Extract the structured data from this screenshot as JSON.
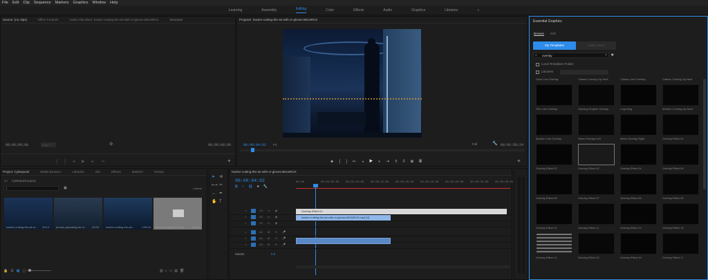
{
  "menu": [
    "File",
    "Edit",
    "Clip",
    "Sequence",
    "Markers",
    "Graphics",
    "Window",
    "Help"
  ],
  "workspaces": [
    "Learning",
    "Assembly",
    "Editing",
    "Color",
    "Effects",
    "Audio",
    "Graphics",
    "Libraries"
  ],
  "workspace_more": "»",
  "source": {
    "tabs": [
      "Source: (no clips)",
      "Effect Controls",
      "Audio Clip Mixer: hacker-cutting-the-air-with-vr-gloves-BNJ4RCK",
      "Metadata"
    ],
    "tc_left": "00;00;00;00",
    "tc_right": "00;00;00;00",
    "page_label": "Page 1"
  },
  "program": {
    "title": "Program: hacker-cutting-the-air-with-vr-gloves-BNJ4RCK",
    "tc_current": "00:00:04:02",
    "fit": "Fit",
    "quality": "Full",
    "tc_end": "00:01:59:24"
  },
  "essential": {
    "title": "Essential Graphics",
    "tabs": [
      "Browse",
      "Edit"
    ],
    "my_templates": "My Templates",
    "adobe_stock": "Adobe Stock",
    "search_value": "overlay",
    "local_folder": "Local Templates Folder",
    "libraries": "Libraries",
    "top_row": [
      "Glow Line Overlay",
      "Classic Coming Up Next",
      "Classic Line Overlay",
      "Classic Coming Up Next"
    ],
    "items": [
      "Film Line Overlay",
      "Gaming Graphic Overlay",
      "Logo Bug",
      "Modern Coming Up Next",
      "Modern Line Overlay",
      "News Overlay Left",
      "News Overlay Right",
      "Overlay Effect 01",
      "Overlay Effect 02",
      "Overlay Effect 03",
      "Overlay Effect 04",
      "Overlay Effect 05",
      "Overlay Effect 06",
      "Overlay Effect 07",
      "Overlay Effect 08",
      "Overlay Effect 09",
      "Overlay Effect 10",
      "Overlay Effect 11",
      "Overlay Effect 12",
      "Overlay Effect 13",
      "Overlay Effect 14",
      "Overlay Effect 15",
      "Overlay Effect 16",
      "Overlay Effect 17"
    ]
  },
  "project": {
    "tabs": [
      "Project: Cyberpunk",
      "Media Browser",
      "Libraries",
      "Info",
      "Effects",
      "Markers",
      "History"
    ],
    "file": "Cyberpunk.prproj",
    "items_count": "4 items",
    "items": [
      {
        "name": "hacker-cutting-the-air-w...",
        "dur": "19:14"
      },
      {
        "name": "person-preparing-for-vr...",
        "dur": "20:00"
      },
      {
        "name": "hacker-cutting-the-air-...",
        "dur": "1:59:24"
      },
      {
        "name": "Motion Graphics Templ...",
        "dur": "0 items"
      }
    ]
  },
  "timeline": {
    "tab": "hacker-cutting-the-air-with-vr-gloves-BNJ4RCK",
    "tc": "00:00:04:02",
    "ruler": [
      "00:00",
      "00:00:05:00",
      "00:00:10:00",
      "00:00:15:00",
      "00:00:20:00",
      "00:00:25:00",
      "00:00:30:00",
      "00:00:35:00",
      "00:00:40:00"
    ],
    "tracks": [
      "V3",
      "V2",
      "V1",
      "A1",
      "A2",
      "A3"
    ],
    "master": "Master",
    "master_val": "0.0",
    "clip_overlay": "Overlay Effect 01",
    "clip_video": "hacker-cutting-the-air-with-vr-gloves-BNJ4RCK.mp4 [V]"
  },
  "colors": {
    "accent": "#2d8ceb",
    "video_clip": "#8fb7e8",
    "overlay_clip": "#d8d8d8",
    "audio_clip": "#5a88c6"
  }
}
